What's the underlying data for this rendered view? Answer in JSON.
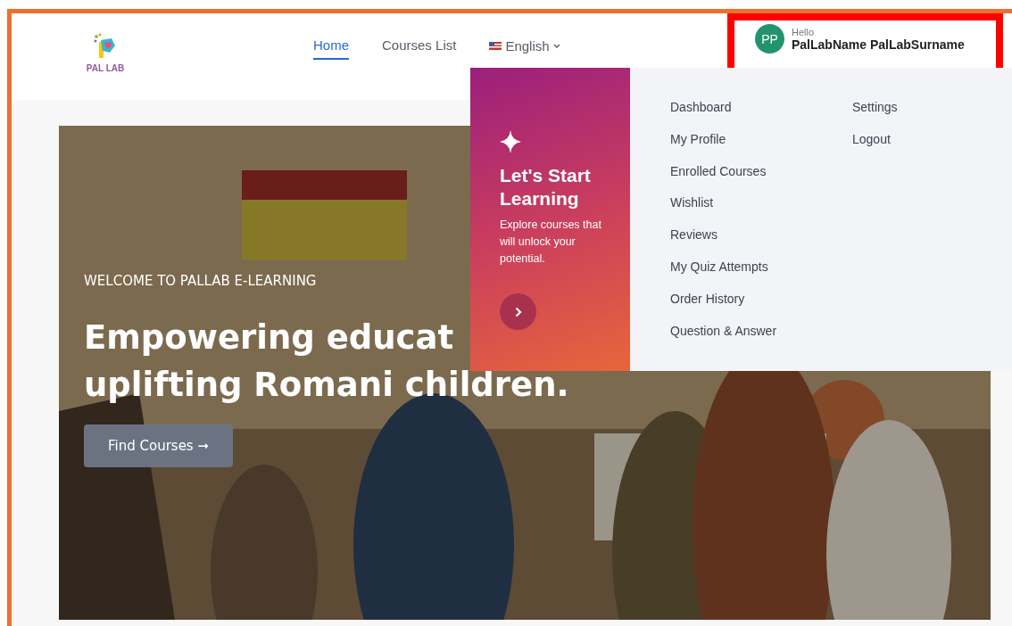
{
  "logo": {
    "text": "PAL LAB"
  },
  "nav": [
    {
      "label": "Home",
      "selected": true
    },
    {
      "label": "Courses List",
      "selected": false
    }
  ],
  "language": {
    "label": "English"
  },
  "user": {
    "initials": "PP",
    "greeting": "Hello",
    "name": "PalLabName PalLabSurname"
  },
  "dropdown": {
    "promo": {
      "title": "Let's Start Learning",
      "text": "Explore courses that will unlock your potential."
    },
    "columns": [
      [
        "Dashboard",
        "My Profile",
        "Enrolled Courses",
        "Wishlist",
        "Reviews",
        "My Quiz Attempts",
        "Order History",
        "Question & Answer"
      ],
      [
        "Settings",
        "Logout"
      ]
    ]
  },
  "hero": {
    "eyebrow": "WELCOME TO PALLAB E-LEARNING",
    "heading": [
      "Empowering educat",
      "uplifting Romani children."
    ],
    "button": "Find Courses ➞"
  }
}
